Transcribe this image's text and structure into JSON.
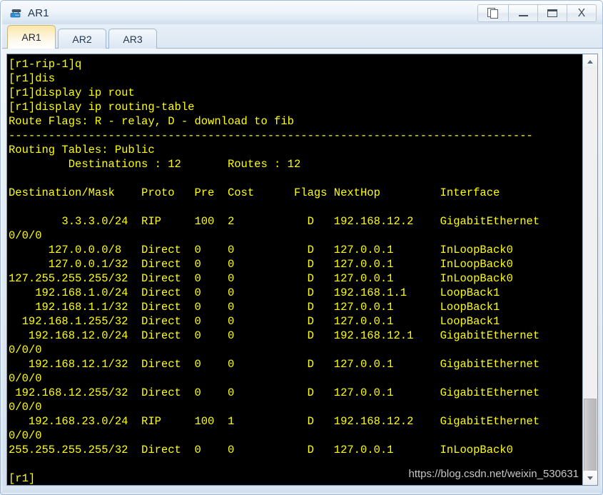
{
  "window": {
    "title": "AR1",
    "icon": "router-icon",
    "controls": [
      {
        "name": "copy-window-button",
        "glyph": "copy-icon",
        "label": ""
      },
      {
        "name": "minimize-button",
        "glyph": "minimize-icon",
        "label": ""
      },
      {
        "name": "maximize-button",
        "glyph": "maximize-icon",
        "label": ""
      },
      {
        "name": "close-button",
        "glyph": "close-icon",
        "label": "X"
      }
    ]
  },
  "tabs": [
    {
      "label": "AR1",
      "active": true
    },
    {
      "label": "AR2",
      "active": false
    },
    {
      "label": "AR3",
      "active": false
    }
  ],
  "terminal": {
    "foreground": "#ffff00",
    "background": "#000000",
    "lines": [
      "[r1-rip-1]q",
      "[r1]dis",
      "[r1]display ip rout",
      "[r1]display ip routing-table",
      "Route Flags: R - relay, D - download to fib",
      "-------------------------------------------------------------------------------",
      "Routing Tables: Public",
      "         Destinations : 12       Routes : 12",
      "",
      "Destination/Mask    Proto   Pre  Cost      Flags NextHop         Interface",
      "",
      "        3.3.3.0/24  RIP     100  2           D   192.168.12.2    GigabitEthernet",
      "0/0/0",
      "      127.0.0.0/8   Direct  0    0           D   127.0.0.1       InLoopBack0",
      "      127.0.0.1/32  Direct  0    0           D   127.0.0.1       InLoopBack0",
      "127.255.255.255/32  Direct  0    0           D   127.0.0.1       InLoopBack0",
      "    192.168.1.0/24  Direct  0    0           D   192.168.1.1     LoopBack1",
      "    192.168.1.1/32  Direct  0    0           D   127.0.0.1       LoopBack1",
      "  192.168.1.255/32  Direct  0    0           D   127.0.0.1       LoopBack1",
      "   192.168.12.0/24  Direct  0    0           D   192.168.12.1    GigabitEthernet",
      "0/0/0",
      "   192.168.12.1/32  Direct  0    0           D   127.0.0.1       GigabitEthernet",
      "0/0/0",
      " 192.168.12.255/32  Direct  0    0           D   127.0.0.1       GigabitEthernet",
      "0/0/0",
      "   192.168.23.0/24  RIP     100  1           D   192.168.12.2    GigabitEthernet",
      "0/0/0",
      "255.255.255.255/32  Direct  0    0           D   127.0.0.1       InLoopBack0",
      "",
      "[r1]"
    ],
    "routing_table": {
      "route_flags": "R - relay, D - download to fib",
      "table_name": "Routing Tables: Public",
      "destinations": "12",
      "routes": "12",
      "columns": [
        "Destination/Mask",
        "Proto",
        "Pre",
        "Cost",
        "Flags",
        "NextHop",
        "Interface"
      ],
      "rows": [
        {
          "destination_mask": "3.3.3.0/24",
          "proto": "RIP",
          "pre": "100",
          "cost": "2",
          "flags": "D",
          "next_hop": "192.168.12.2",
          "interface": "GigabitEthernet0/0/0"
        },
        {
          "destination_mask": "127.0.0.0/8",
          "proto": "Direct",
          "pre": "0",
          "cost": "0",
          "flags": "D",
          "next_hop": "127.0.0.1",
          "interface": "InLoopBack0"
        },
        {
          "destination_mask": "127.0.0.1/32",
          "proto": "Direct",
          "pre": "0",
          "cost": "0",
          "flags": "D",
          "next_hop": "127.0.0.1",
          "interface": "InLoopBack0"
        },
        {
          "destination_mask": "127.255.255.255/32",
          "proto": "Direct",
          "pre": "0",
          "cost": "0",
          "flags": "D",
          "next_hop": "127.0.0.1",
          "interface": "InLoopBack0"
        },
        {
          "destination_mask": "192.168.1.0/24",
          "proto": "Direct",
          "pre": "0",
          "cost": "0",
          "flags": "D",
          "next_hop": "192.168.1.1",
          "interface": "LoopBack1"
        },
        {
          "destination_mask": "192.168.1.1/32",
          "proto": "Direct",
          "pre": "0",
          "cost": "0",
          "flags": "D",
          "next_hop": "127.0.0.1",
          "interface": "LoopBack1"
        },
        {
          "destination_mask": "192.168.1.255/32",
          "proto": "Direct",
          "pre": "0",
          "cost": "0",
          "flags": "D",
          "next_hop": "127.0.0.1",
          "interface": "LoopBack1"
        },
        {
          "destination_mask": "192.168.12.0/24",
          "proto": "Direct",
          "pre": "0",
          "cost": "0",
          "flags": "D",
          "next_hop": "192.168.12.1",
          "interface": "GigabitEthernet0/0/0"
        },
        {
          "destination_mask": "192.168.12.1/32",
          "proto": "Direct",
          "pre": "0",
          "cost": "0",
          "flags": "D",
          "next_hop": "127.0.0.1",
          "interface": "GigabitEthernet0/0/0"
        },
        {
          "destination_mask": "192.168.12.255/32",
          "proto": "Direct",
          "pre": "0",
          "cost": "0",
          "flags": "D",
          "next_hop": "127.0.0.1",
          "interface": "GigabitEthernet0/0/0"
        },
        {
          "destination_mask": "192.168.23.0/24",
          "proto": "RIP",
          "pre": "100",
          "cost": "1",
          "flags": "D",
          "next_hop": "192.168.12.2",
          "interface": "GigabitEthernet0/0/0"
        },
        {
          "destination_mask": "255.255.255.255/32",
          "proto": "Direct",
          "pre": "0",
          "cost": "0",
          "flags": "D",
          "next_hop": "127.0.0.1",
          "interface": "InLoopBack0"
        }
      ]
    }
  },
  "scrollbar": {
    "up_arrow": "chevron-up-icon",
    "down_arrow": "chevron-down-icon"
  },
  "watermark": {
    "text": "https://blog.csdn.net/weixin_530631"
  }
}
